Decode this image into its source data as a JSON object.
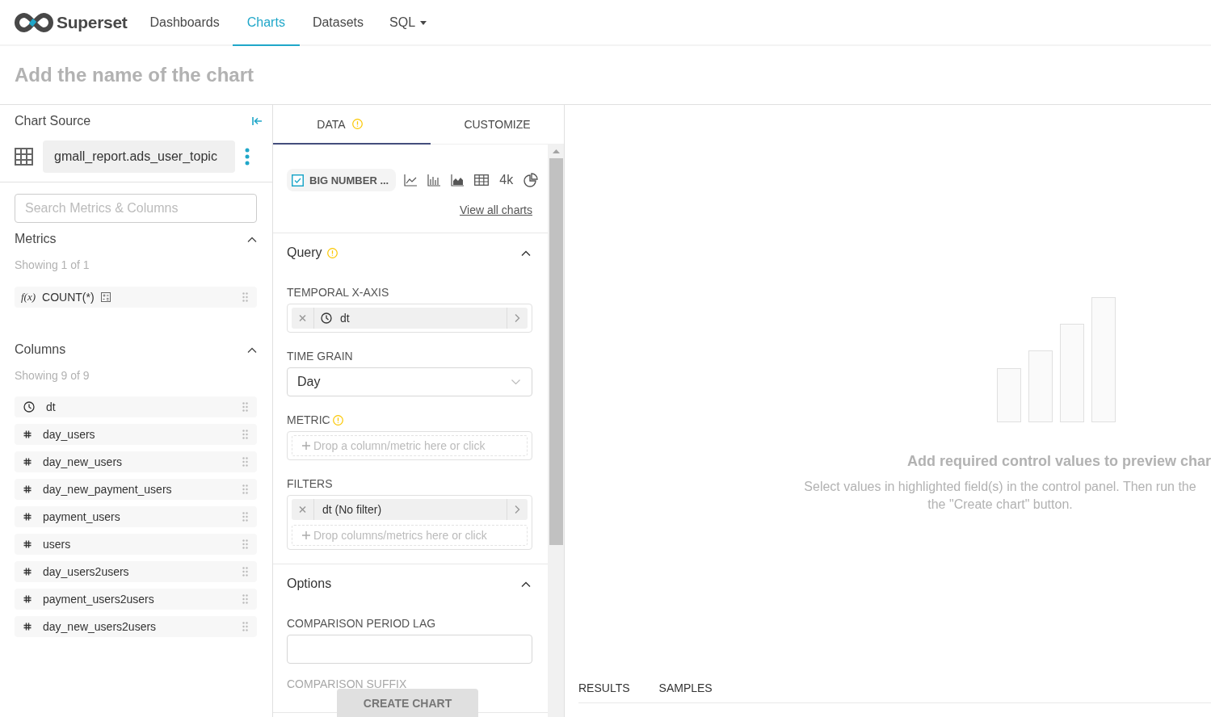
{
  "nav": {
    "brand": "Superset",
    "items": [
      {
        "label": "Dashboards",
        "selected": false,
        "dropdown": false
      },
      {
        "label": "Charts",
        "selected": true,
        "dropdown": false
      },
      {
        "label": "Datasets",
        "selected": false,
        "dropdown": false
      },
      {
        "label": "SQL",
        "selected": false,
        "dropdown": true
      }
    ]
  },
  "chart_title": {
    "placeholder": "Add the name of the chart"
  },
  "source": {
    "heading": "Chart Source",
    "dataset": "gmall_report.ads_user_topic"
  },
  "search": {
    "placeholder": "Search Metrics & Columns"
  },
  "metrics": {
    "heading": "Metrics",
    "expanded": true,
    "count": "Showing 1 of 1",
    "items": [
      {
        "prefix": "f(x)",
        "name": "COUNT(*)"
      }
    ]
  },
  "columns": {
    "heading": "Columns",
    "expanded": true,
    "count": "Showing 9 of 9",
    "items": [
      {
        "name": "dt",
        "kind": "time"
      },
      {
        "name": "day_users",
        "kind": "number"
      },
      {
        "name": "day_new_users",
        "kind": "number"
      },
      {
        "name": "day_new_payment_users",
        "kind": "number"
      },
      {
        "name": "payment_users",
        "kind": "number"
      },
      {
        "name": "users",
        "kind": "number"
      },
      {
        "name": "day_users2users",
        "kind": "number"
      },
      {
        "name": "payment_users2users",
        "kind": "number"
      },
      {
        "name": "day_new_users2users",
        "kind": "number"
      }
    ]
  },
  "panel_tabs": [
    {
      "label": "DATA",
      "selected": true,
      "warning": true
    },
    {
      "label": "CUSTOMIZE",
      "selected": false,
      "warning": false
    }
  ],
  "chart_type": {
    "label": "BIG NUMBER ...",
    "selected": true
  },
  "recent_types": [
    {
      "kind": "line"
    },
    {
      "kind": "bar"
    },
    {
      "kind": "area"
    },
    {
      "kind": "table"
    },
    {
      "kind": "text",
      "label": "4k"
    },
    {
      "kind": "pie"
    }
  ],
  "view_all": "View all charts",
  "sections": [
    {
      "title": "Query",
      "warning": true,
      "expanded": true,
      "controls": [
        {
          "kind": "pill",
          "label": "TEMPORAL X-AXIS",
          "warning": false,
          "value": "dt"
        },
        {
          "kind": "select",
          "label": "TIME GRAIN",
          "warning": false,
          "value": "Day"
        },
        {
          "kind": "drop",
          "label": "METRIC",
          "warning": true,
          "placeholder": "Drop a column/metric here or click"
        },
        {
          "kind": "filters",
          "label": "FILTERS",
          "warning": false,
          "value": "dt (No filter)",
          "placeholder": "Drop columns/metrics here or click"
        }
      ]
    },
    {
      "title": "Options",
      "warning": false,
      "expanded": true,
      "controls": [
        {
          "kind": "input",
          "label": "COMPARISON PERIOD LAG",
          "warning": false
        },
        {
          "kind": "label",
          "label": "COMPARISON SUFFIX",
          "warning": false
        }
      ]
    }
  ],
  "create_button": {
    "label": "CREATE CHART",
    "disabled": true
  },
  "preview": {
    "title": "Add required control values to preview char",
    "message_lines": [
      "Select values in highlighted field(s) in the control panel. Then run the",
      "the \"Create chart\" button."
    ]
  },
  "data_tabs": [
    {
      "label": "RESULTS",
      "selected": false
    },
    {
      "label": "SAMPLES",
      "selected": false
    }
  ]
}
